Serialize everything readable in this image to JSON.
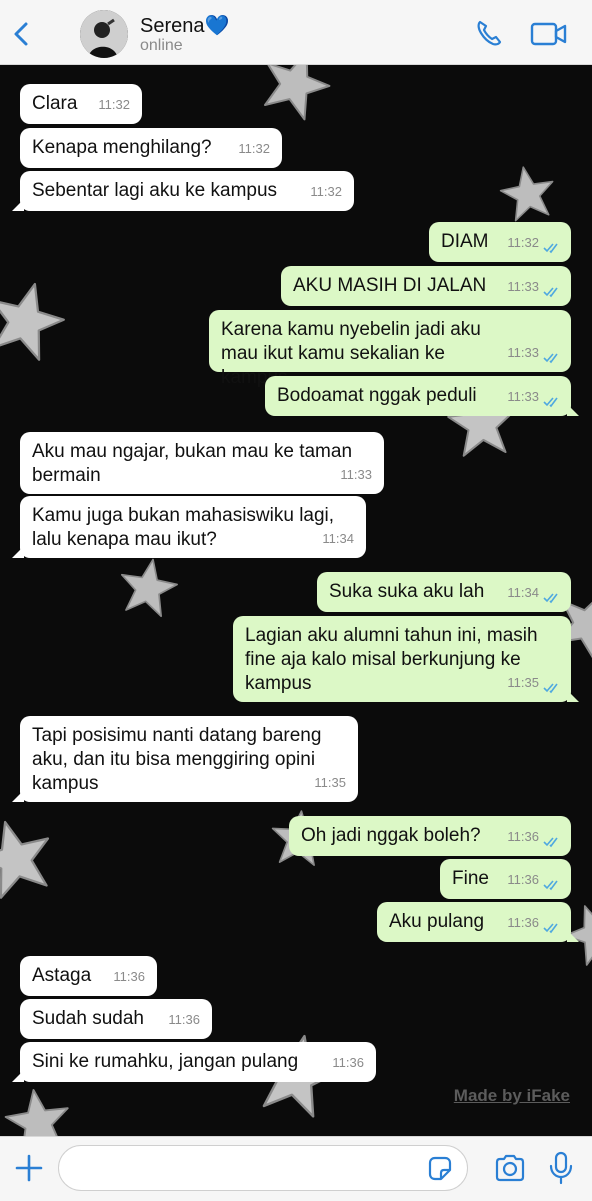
{
  "header": {
    "contact_name": "Serena💙",
    "status": "online"
  },
  "messages": [
    {
      "side": "in",
      "text": "Clara",
      "time": "11:32"
    },
    {
      "side": "in",
      "text": "Kenapa menghilang?",
      "time": "11:32"
    },
    {
      "side": "in",
      "text": "Sebentar lagi aku ke kampus",
      "time": "11:32"
    },
    {
      "side": "out",
      "text": "DIAM",
      "time": "11:32"
    },
    {
      "side": "out",
      "text": "AKU MASIH DI JALAN",
      "time": "11:33"
    },
    {
      "side": "out",
      "text": "Karena kamu nyebelin jadi aku mau ikut kamu sekalian ke kampus",
      "time": "11:33"
    },
    {
      "side": "out",
      "text": "Bodoamat nggak peduli",
      "time": "11:33"
    },
    {
      "side": "in",
      "text": "Aku mau ngajar, bukan mau ke taman bermain",
      "time": "11:33"
    },
    {
      "side": "in",
      "text": "Kamu juga bukan mahasiswiku lagi, lalu kenapa mau ikut?",
      "time": "11:34"
    },
    {
      "side": "out",
      "text": "Suka suka aku lah",
      "time": "11:34"
    },
    {
      "side": "out",
      "text": "Lagian aku alumni tahun ini, masih fine aja kalo misal berkunjung ke kampus",
      "time": "11:35"
    },
    {
      "side": "in",
      "text": "Tapi posisimu nanti datang bareng aku, dan itu bisa menggiring opini kampus",
      "time": "11:35"
    },
    {
      "side": "out",
      "text": "Oh jadi nggak boleh?",
      "time": "11:36"
    },
    {
      "side": "out",
      "text": "Fine",
      "time": "11:36"
    },
    {
      "side": "out",
      "text": "Aku pulang",
      "time": "11:36"
    },
    {
      "side": "in",
      "text": "Astaga",
      "time": "11:36"
    },
    {
      "side": "in",
      "text": "Sudah sudah",
      "time": "11:36"
    },
    {
      "side": "in",
      "text": "Sini ke rumahku, jangan pulang",
      "time": "11:36"
    }
  ],
  "watermark": "Made by iFake",
  "composer": {
    "placeholder": ""
  },
  "colors": {
    "accent": "#2a7fd4",
    "outgoing_bubble": "#dcf8c6",
    "incoming_bubble": "#ffffff",
    "read_ticks": "#4fa8e0",
    "chat_background": "#0b0b0b"
  },
  "icons": [
    "back-chevron-icon",
    "phone-icon",
    "video-camera-icon",
    "plus-icon",
    "sticker-icon",
    "camera-icon",
    "microphone-icon",
    "double-check-icon",
    "star-decoration-icon"
  ]
}
